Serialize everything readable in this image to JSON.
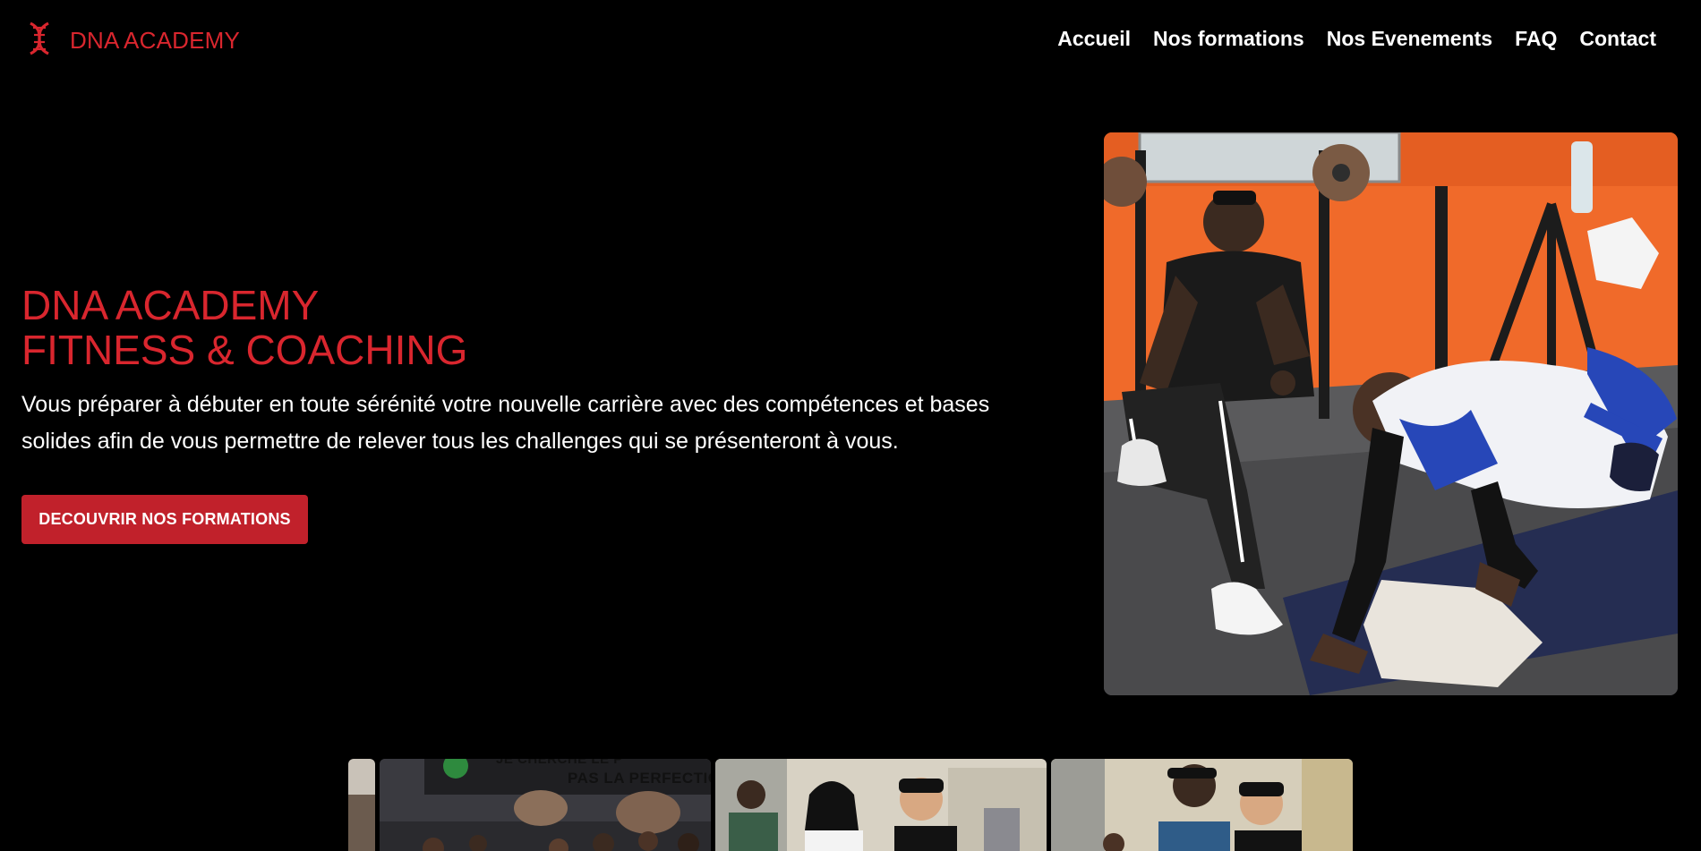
{
  "header": {
    "brand": "DNA ACADEMY",
    "logo_icon": "dna-icon",
    "nav": [
      {
        "label": "Accueil"
      },
      {
        "label": "Nos formations"
      },
      {
        "label": "Nos Evenements"
      },
      {
        "label": "FAQ"
      },
      {
        "label": "Contact"
      }
    ]
  },
  "hero": {
    "title_line1": "DNA ACADEMY",
    "title_line2": "FITNESS & COACHING",
    "description": "Vous préparer à débuter en toute sérénité votre nouvelle carrière avec des compétences et bases solides afin de vous permettre de relever tous les challenges qui se présenteront à vous.",
    "cta_label": "DECOUVRIR NOS FORMATIONS",
    "image_alt": "Coach guiding a trainee doing an exercise on a mat in a gym"
  },
  "gallery": {
    "banner_text_partial": "JE CHERCHE LE P",
    "banner_text_line2": "PAS LA PERFECTIO"
  },
  "colors": {
    "accent": "#d9262e",
    "button": "#c1212b",
    "background": "#000000",
    "text": "#ffffff"
  }
}
